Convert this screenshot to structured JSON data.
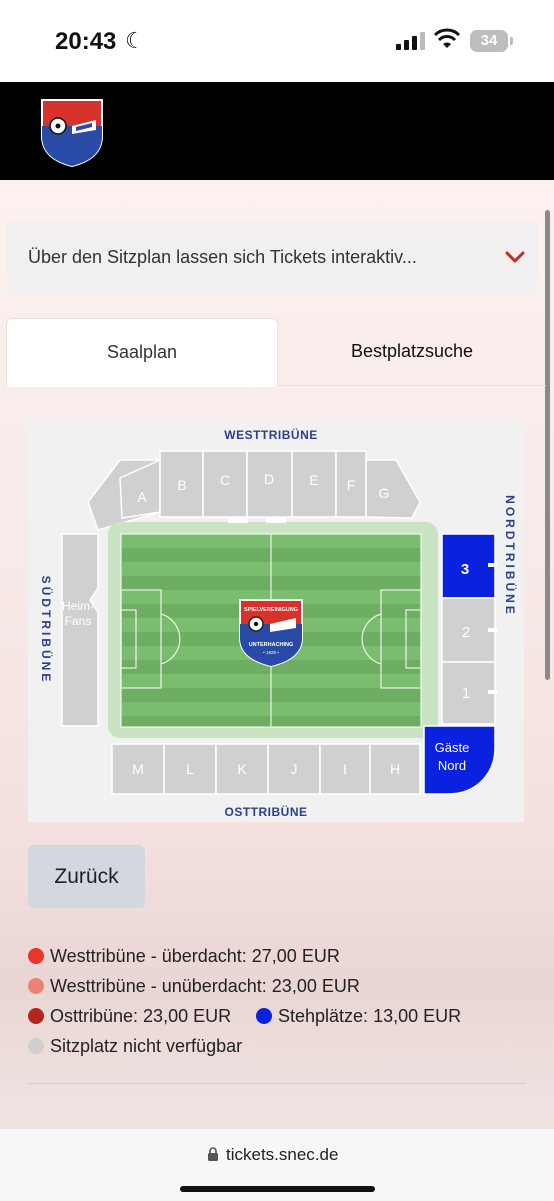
{
  "status": {
    "time": "20:43",
    "battery": "34"
  },
  "info": {
    "text": "Über den Sitzplan lassen sich Tickets interaktiv..."
  },
  "tabs": [
    {
      "label": "Saalplan",
      "active": true
    },
    {
      "label": "Bestplatzsuche",
      "active": false
    }
  ],
  "stadium": {
    "west_label": "WESTTRIBÜNE",
    "ost_label": "OSTTRIBÜNE",
    "sued_label": "SÜDTRIBÜNE",
    "nord_label": "NORDTRIBÜNE",
    "west_blocks": [
      "A",
      "B",
      "C",
      "D",
      "E",
      "F",
      "G"
    ],
    "ost_blocks": [
      "M",
      "L",
      "K",
      "J",
      "I",
      "H"
    ],
    "heim_label_1": "Heim-",
    "heim_label_2": "Fans",
    "nord_blocks": [
      "3",
      "2",
      "1"
    ],
    "gaeste_label_1": "Gäste",
    "gaeste_label_2": "Nord",
    "club_top": "SPIELVEREINIGUNG",
    "club_bottom": "UNTERHACHING",
    "club_year": "• 1925 •"
  },
  "back_button": "Zurück",
  "legend": [
    {
      "label": "Westtribüne - überdacht: 27,00 EUR",
      "color": "#e8362a"
    },
    {
      "label": "Westtribüne - unüberdacht: 23,00 EUR",
      "color": "#ef8077"
    },
    {
      "label": "Osttribüne: 23,00 EUR",
      "color": "#b3261e"
    },
    {
      "label": "Stehplätze: 13,00 EUR",
      "color": "#0a22e0"
    },
    {
      "label": "Sitzplatz nicht verfügbar",
      "color": "#cfcfcf"
    }
  ],
  "url": "tickets.snec.de"
}
